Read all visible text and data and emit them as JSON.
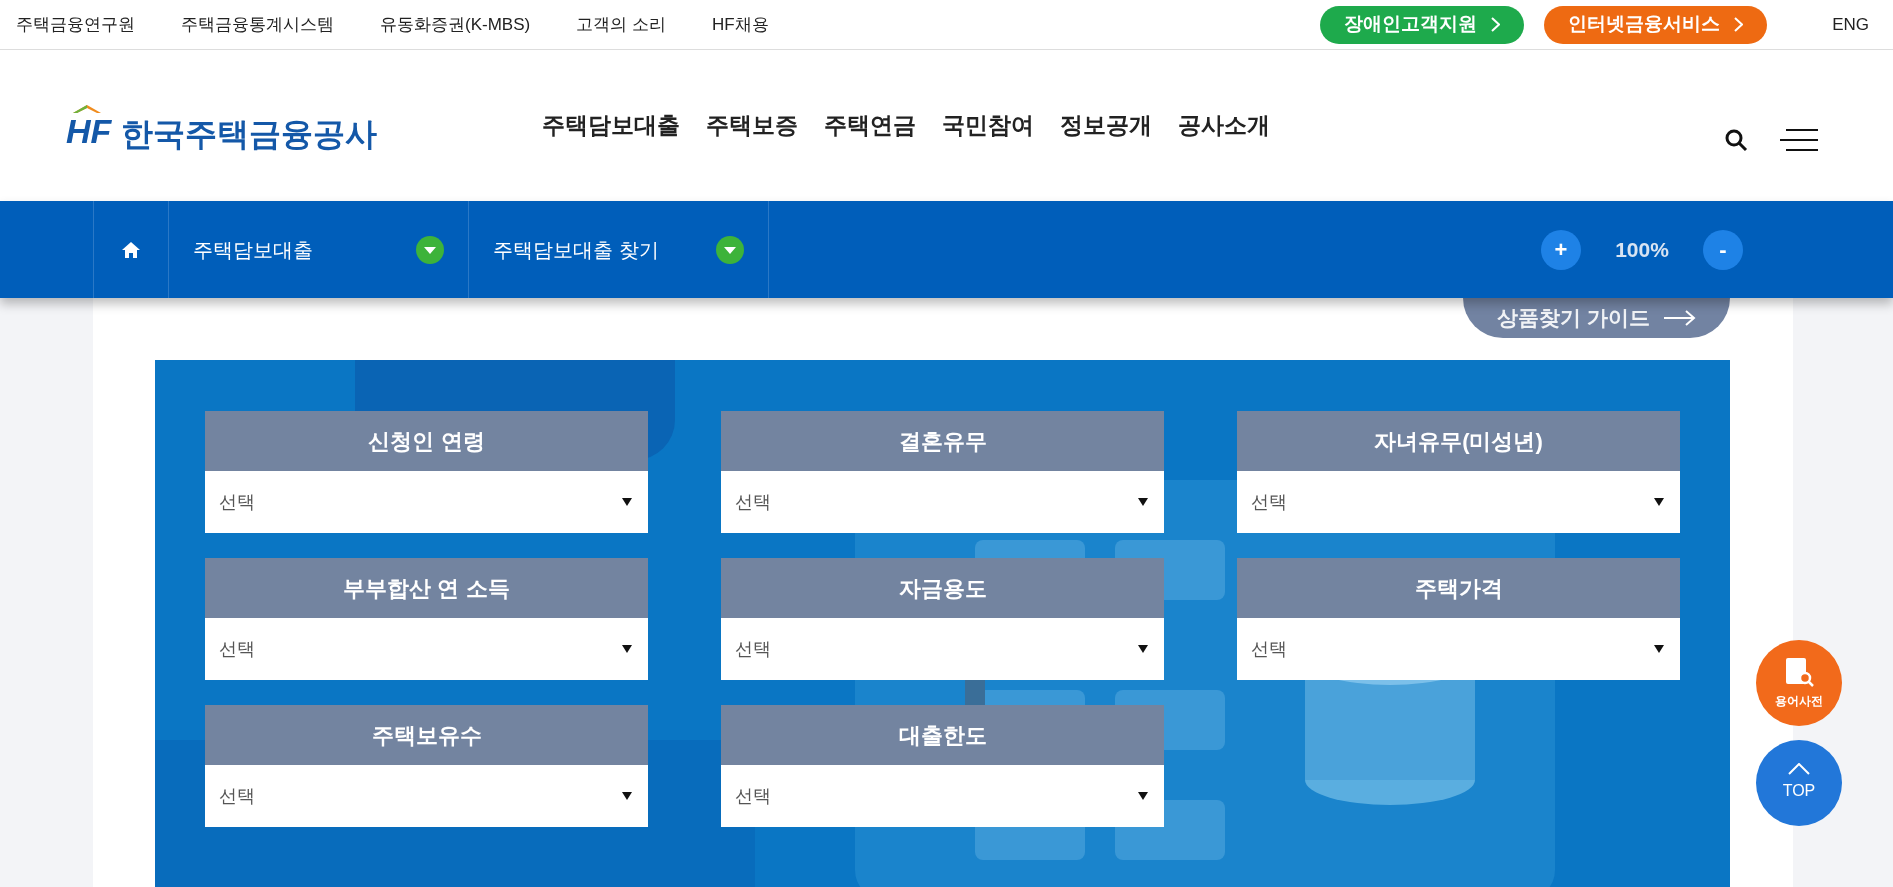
{
  "top_links": [
    "주택금융연구원",
    "주택금융통계시스템",
    "유동화증권(K-MBS)",
    "고객의 소리",
    "HF채용"
  ],
  "top_buttons": [
    {
      "label": "장애인고객지원",
      "kind": "green"
    },
    {
      "label": "인터넷금융서비스",
      "kind": "orange"
    }
  ],
  "language": "ENG",
  "logo": {
    "mark": "HF",
    "name": "한국주택금융공사"
  },
  "main_menu": [
    "주택담보대출",
    "주택보증",
    "주택연금",
    "국민참여",
    "정보공개",
    "공사소개"
  ],
  "breadcrumb": [
    "주택담보대출",
    "주택담보대출 찾기"
  ],
  "zoom": {
    "plus": "+",
    "value": "100%",
    "minus": "-"
  },
  "guide_button": "상품찾기 가이드",
  "filters": [
    {
      "label": "신청인 연령",
      "value": "선택"
    },
    {
      "label": "결혼유무",
      "value": "선택"
    },
    {
      "label": "자녀유무(미성년)",
      "value": "선택"
    },
    {
      "label": "부부합산 연 소득",
      "value": "선택"
    },
    {
      "label": "자금용도",
      "value": "선택"
    },
    {
      "label": "주택가격",
      "value": "선택"
    },
    {
      "label": "주택보유수",
      "value": "선택"
    },
    {
      "label": "대출한도",
      "value": "선택"
    }
  ],
  "floating": [
    {
      "kind": "dictionary",
      "label": "용어사전"
    },
    {
      "kind": "top",
      "label": "TOP"
    }
  ]
}
